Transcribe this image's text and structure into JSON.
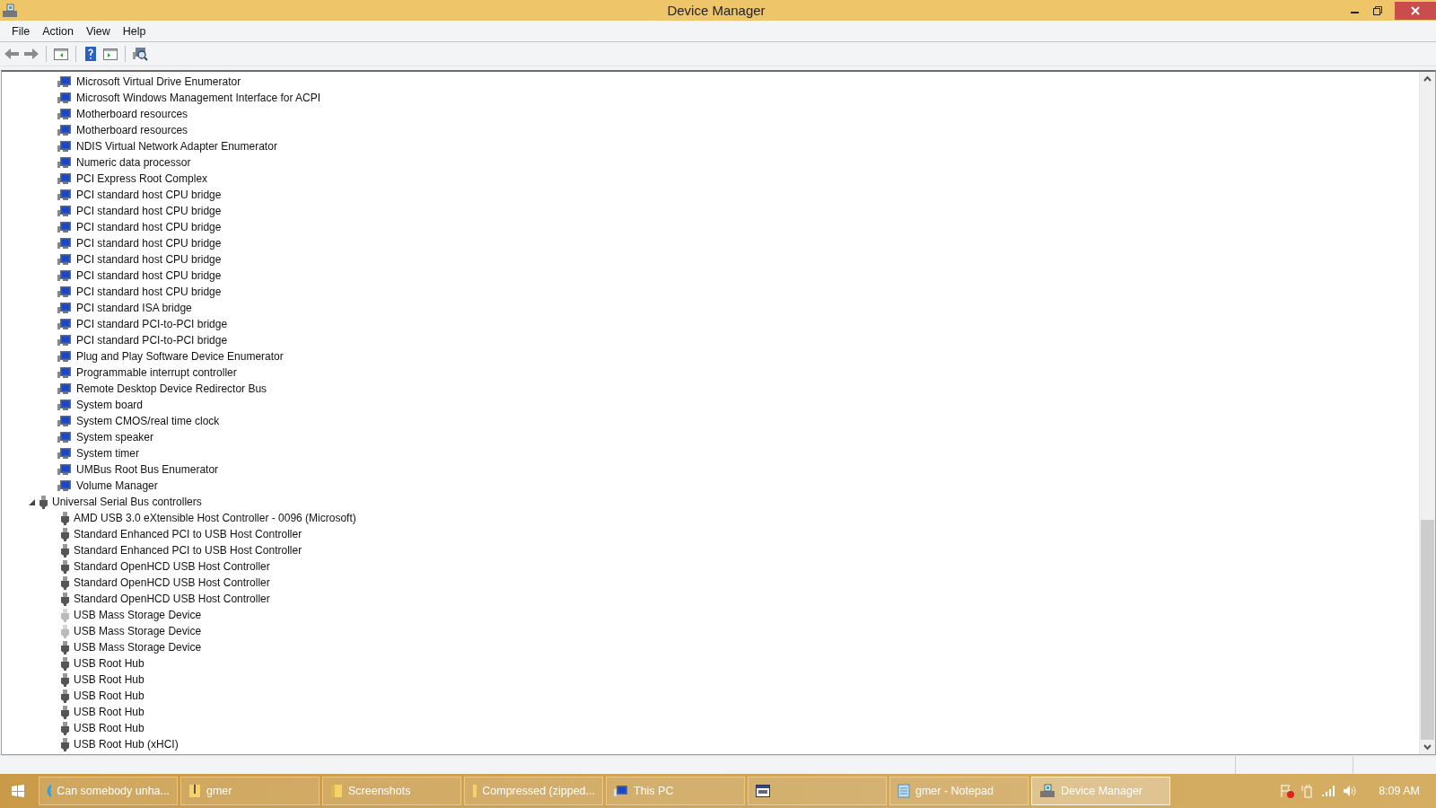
{
  "window": {
    "title": "Device Manager"
  },
  "menu": [
    "File",
    "Action",
    "View",
    "Help"
  ],
  "tree": [
    {
      "kind": "system",
      "children": [
        {
          "label": "Microsoft Virtual Drive Enumerator"
        },
        {
          "label": "Microsoft Windows Management Interface for ACPI"
        },
        {
          "label": "Motherboard resources"
        },
        {
          "label": "Motherboard resources"
        },
        {
          "label": "NDIS Virtual Network Adapter Enumerator"
        },
        {
          "label": "Numeric data processor"
        },
        {
          "label": "PCI Express Root Complex"
        },
        {
          "label": "PCI standard host CPU bridge"
        },
        {
          "label": "PCI standard host CPU bridge"
        },
        {
          "label": "PCI standard host CPU bridge"
        },
        {
          "label": "PCI standard host CPU bridge"
        },
        {
          "label": "PCI standard host CPU bridge"
        },
        {
          "label": "PCI standard host CPU bridge"
        },
        {
          "label": "PCI standard host CPU bridge"
        },
        {
          "label": "PCI standard ISA bridge"
        },
        {
          "label": "PCI standard PCI-to-PCI bridge"
        },
        {
          "label": "PCI standard PCI-to-PCI bridge"
        },
        {
          "label": "Plug and Play Software Device Enumerator"
        },
        {
          "label": "Programmable interrupt controller"
        },
        {
          "label": "Remote Desktop Device Redirector Bus"
        },
        {
          "label": "System board"
        },
        {
          "label": "System CMOS/real time clock"
        },
        {
          "label": "System speaker"
        },
        {
          "label": "System timer"
        },
        {
          "label": "UMBus Root Bus Enumerator"
        },
        {
          "label": "Volume Manager"
        }
      ]
    },
    {
      "kind": "usb",
      "label": "Universal Serial Bus controllers",
      "expanded": true,
      "children": [
        {
          "label": "AMD USB 3.0 eXtensible Host Controller - 0096 (Microsoft)",
          "ghost": false
        },
        {
          "label": "Standard Enhanced PCI to USB Host Controller",
          "ghost": false
        },
        {
          "label": "Standard Enhanced PCI to USB Host Controller",
          "ghost": false
        },
        {
          "label": "Standard OpenHCD USB Host Controller",
          "ghost": false
        },
        {
          "label": "Standard OpenHCD USB Host Controller",
          "ghost": false
        },
        {
          "label": "Standard OpenHCD USB Host Controller",
          "ghost": false
        },
        {
          "label": "USB Mass Storage Device",
          "ghost": true
        },
        {
          "label": "USB Mass Storage Device",
          "ghost": true
        },
        {
          "label": "USB Mass Storage Device",
          "ghost": false
        },
        {
          "label": "USB Root Hub",
          "ghost": false
        },
        {
          "label": "USB Root Hub",
          "ghost": false
        },
        {
          "label": "USB Root Hub",
          "ghost": false
        },
        {
          "label": "USB Root Hub",
          "ghost": false
        },
        {
          "label": "USB Root Hub",
          "ghost": false
        },
        {
          "label": "USB Root Hub (xHCI)",
          "ghost": false
        }
      ]
    }
  ],
  "taskbar": {
    "buttons": [
      {
        "kind": "browser",
        "label": "Can somebody unha...",
        "selected": false
      },
      {
        "kind": "zip",
        "label": "gmer",
        "selected": false
      },
      {
        "kind": "folder",
        "label": "Screenshots",
        "selected": false
      },
      {
        "kind": "zip",
        "label": "Compressed (zipped...",
        "selected": false
      },
      {
        "kind": "pc",
        "label": "This PC",
        "selected": false
      },
      {
        "kind": "app",
        "selected": false
      },
      {
        "kind": "notepad",
        "label": "gmer - Notepad",
        "selected": false
      },
      {
        "kind": "devmgr",
        "label": "Device Manager",
        "selected": true
      }
    ],
    "clock": "8:09 AM"
  }
}
